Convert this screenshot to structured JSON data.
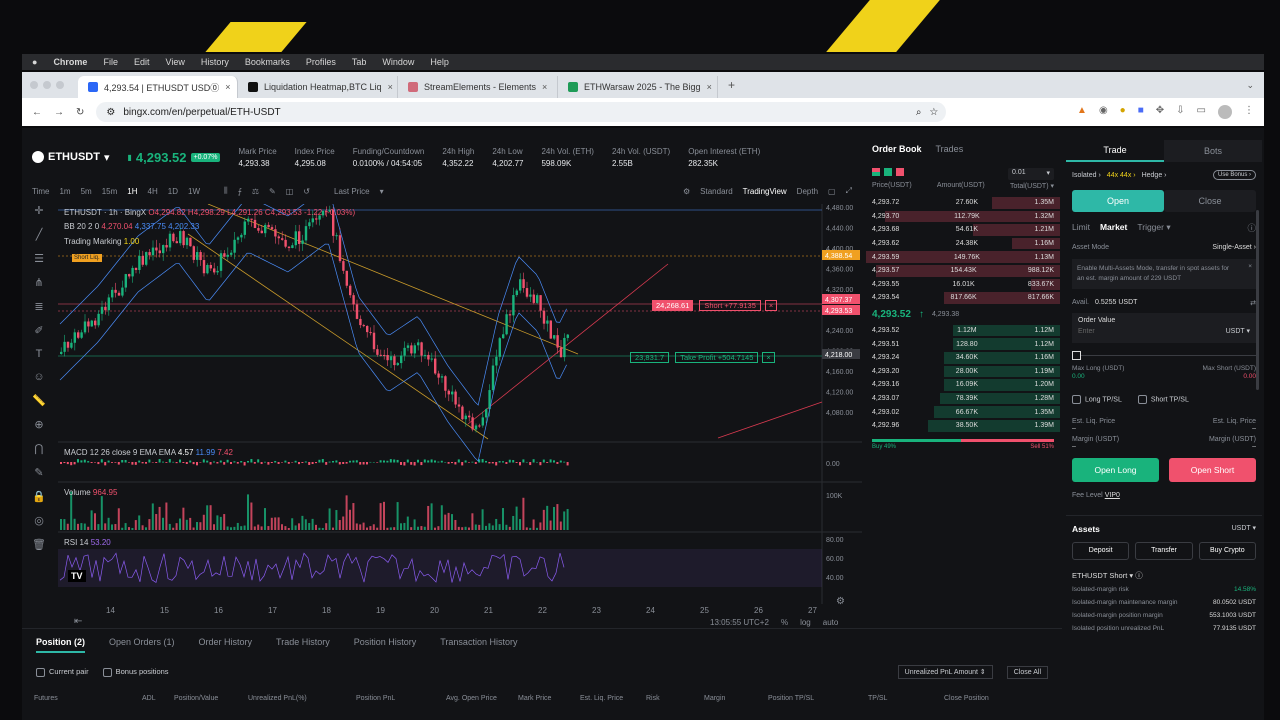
{
  "colors": {
    "green": "#19b37c",
    "red": "#f0516d",
    "teal": "#2eb8a7",
    "accent": "#f0d21a"
  },
  "menu": {
    "apple": "",
    "items": [
      "Chrome",
      "File",
      "Edit",
      "View",
      "History",
      "Bookmarks",
      "Profiles",
      "Tab",
      "Window",
      "Help"
    ]
  },
  "tabs": [
    {
      "label": "4,293.54 | ETHUSDT USD⓪",
      "icon": "bingx-icon"
    },
    {
      "label": "Liquidation Heatmap,BTC Liq",
      "icon": "coinglass-icon"
    },
    {
      "label": "StreamElements - Elements",
      "icon": "streamelements-icon"
    },
    {
      "label": "ETHWarsaw 2025 - The Bigg",
      "icon": "ethwarsaw-icon"
    }
  ],
  "address": {
    "url": "bingx.com/en/perpetual/ETH-USDT"
  },
  "header": {
    "symbol": "ETHUSDT",
    "price": "4,293.52",
    "change": "+0.07%",
    "stats": [
      {
        "label": "Mark Price",
        "value": "4,293.38"
      },
      {
        "label": "Index Price",
        "value": "4,295.08"
      },
      {
        "label": "Funding/Countdown",
        "value": "0.0100% / 04:54:05"
      },
      {
        "label": "24h High",
        "value": "4,352.22"
      },
      {
        "label": "24h Low",
        "value": "4,202.77"
      },
      {
        "label": "24h Vol. (ETH)",
        "value": "598.09K"
      },
      {
        "label": "24h Vol. (USDT)",
        "value": "2.55B"
      },
      {
        "label": "Open Interest (ETH)",
        "value": "282.35K"
      }
    ]
  },
  "toolbar": {
    "items": [
      "Time",
      "1m",
      "5m",
      "15m",
      "1H",
      "4H",
      "1D",
      "1W"
    ],
    "active": "1H",
    "last_price": "Last Price",
    "modes": [
      "Standard",
      "TradingView",
      "Depth"
    ],
    "mode_active": "TradingView"
  },
  "chart": {
    "legend1": "ETHUSDT · 1h · BingX",
    "ohlc": "O4,294.82 H4,298.29 L4,291.26 C4,293.53 -1.22 (-0.03%)",
    "bb": "BB 20 2 0",
    "bb_vals": [
      "4,270.04",
      "4,337.75",
      "4,202.33"
    ],
    "marking": "Trading Marking",
    "marking_val": "1.00",
    "short_label": "Short",
    "short_pnl": "+77.9135",
    "short_price": "24,268.61",
    "tp_label": "Take Profit",
    "tp_pnl": "+504.7145",
    "tp_price": "23,831.7",
    "liq_label": "Short Liq.",
    "price_tags": [
      "4,388.54",
      "4,307.37",
      "4,293.53",
      "4,218.00"
    ],
    "y_ticks": [
      "4,480.00",
      "4,440.00",
      "4,400.00",
      "4,360.00",
      "4,320.00",
      "4,280.00",
      "4,240.00",
      "4,200.00",
      "4,160.00",
      "4,120.00",
      "4,080.00"
    ],
    "macd": "MACD 12 26 close 9 EMA EMA",
    "macd_vals": [
      "4.57",
      "11.99",
      "7.42"
    ],
    "macd_tick": "0.00",
    "volume": "Volume",
    "volume_val": "964.95",
    "vol_tick": "100K",
    "rsi": "RSI 14",
    "rsi_val": "53.20",
    "rsi_ticks": [
      "80.00",
      "60.00",
      "40.00"
    ],
    "x_ticks": [
      "14",
      "15",
      "16",
      "17",
      "18",
      "19",
      "20",
      "21",
      "22",
      "23",
      "24",
      "25",
      "26",
      "27"
    ],
    "time": "13:05:55 UTC+2",
    "pct": "%",
    "log": "log",
    "auto": "auto"
  },
  "orderbook": {
    "tab1": "Order Book",
    "tab2": "Trades",
    "precision": "0.01",
    "col_price": "Price(USDT)",
    "col_amount": "Amount(USDT)",
    "col_total": "Total(USDT)",
    "asks": [
      [
        "4,293.72",
        "27.60K",
        "1.35M",
        0.35
      ],
      [
        "4,293.70",
        "112.79K",
        "1.32M",
        0.9
      ],
      [
        "4,293.68",
        "54.61K",
        "1.21M",
        0.45
      ],
      [
        "4,293.62",
        "24.38K",
        "1.16M",
        0.25
      ],
      [
        "4,293.59",
        "149.76K",
        "1.13M",
        1.0
      ],
      [
        "4,293.57",
        "154.43K",
        "988.12K",
        0.95
      ],
      [
        "4,293.55",
        "16.01K",
        "833.67K",
        0.15
      ],
      [
        "4,293.54",
        "817.66K",
        "817.66K",
        0.6
      ]
    ],
    "mid_price": "4,293.52",
    "mid_arrow": "↑",
    "mid_mark": "4,293.38",
    "bids": [
      [
        "4,293.52",
        "1.12M",
        "1.12M",
        0.55
      ],
      [
        "4,293.51",
        "128.80",
        "1.12M",
        0.55
      ],
      [
        "4,293.24",
        "34.60K",
        "1.16M",
        0.6
      ],
      [
        "4,293.20",
        "28.00K",
        "1.19M",
        0.6
      ],
      [
        "4,293.16",
        "16.09K",
        "1.20M",
        0.6
      ],
      [
        "4,293.07",
        "78.39K",
        "1.28M",
        0.62
      ],
      [
        "4,293.02",
        "66.67K",
        "1.35M",
        0.65
      ],
      [
        "4,292.96",
        "38.50K",
        "1.39M",
        0.68
      ]
    ],
    "buy_pct": "Buy 49%",
    "sell_pct": "Sell 51%",
    "buy_ratio": 0.49
  },
  "trade": {
    "tab1": "Trade",
    "tab2": "Bots",
    "isolated": "Isolated ›",
    "lev": "44x 44x ›",
    "hedge": "Hedge ›",
    "bonus": "Use Bonus ›",
    "open": "Open",
    "close": "Close",
    "types": [
      "Limit",
      "Market",
      "Trigger ▾"
    ],
    "asset_mode": "Asset Mode",
    "asset_mode_val": "Single-Asset ›",
    "notice": "Enable Multi-Assets Mode, transfer in spot assets for an est. margin amount of 229 USDT",
    "avail": "Avail.",
    "avail_val": "0.5255 USDT",
    "order_value": "Order Value",
    "enter": "Enter",
    "unit": "USDT ▾",
    "max_long": "Max Long (USDT)",
    "max_long_val": "0.00",
    "max_short": "Max Short (USDT)",
    "max_short_val": "0.00",
    "long_tpsl": "Long TP/SL",
    "short_tpsl": "Short TP/SL",
    "est_liq": "Est. Liq. Price",
    "est_liq2": "Est. Liq. Price",
    "margin": "Margin (USDT)",
    "margin2": "Margin (USDT)",
    "dash": "–",
    "open_long": "Open Long",
    "open_short": "Open Short",
    "fee": "Fee Level",
    "fee_val": "VIP0",
    "assets": "Assets",
    "assets_unit": "USDT ▾",
    "deposit": "Deposit",
    "transfer": "Transfer",
    "buy": "Buy Crypto",
    "pos_title": "ETHUSDT Short ▾ ⓘ",
    "pos_rows": [
      [
        "Isolated-margin risk",
        "14.58%"
      ],
      [
        "Isolated-margin maintenance margin",
        "80.0502 USDT"
      ],
      [
        "Isolated-margin position margin",
        "553.1003 USDT"
      ],
      [
        "Isolated position unrealized PnL",
        "77.9135 USDT"
      ]
    ]
  },
  "bottom": {
    "tabs": [
      "Position (2)",
      "Open Orders (1)",
      "Order History",
      "Trade History",
      "Position History",
      "Transaction History"
    ],
    "current_pair": "Current pair",
    "bonus_pos": "Bonus positions",
    "pnl_sel": "Unrealized PnL Amount",
    "close_all": "Close All",
    "cols": [
      "Futures",
      "ADL",
      "Position/Value",
      "Unrealized PnL(%)",
      "Position PnL",
      "Avg. Open Price",
      "Mark Price",
      "Est. Liq. Price",
      "Risk",
      "Margin",
      "Position TP/SL",
      "TP/SL",
      "Close Position"
    ]
  }
}
